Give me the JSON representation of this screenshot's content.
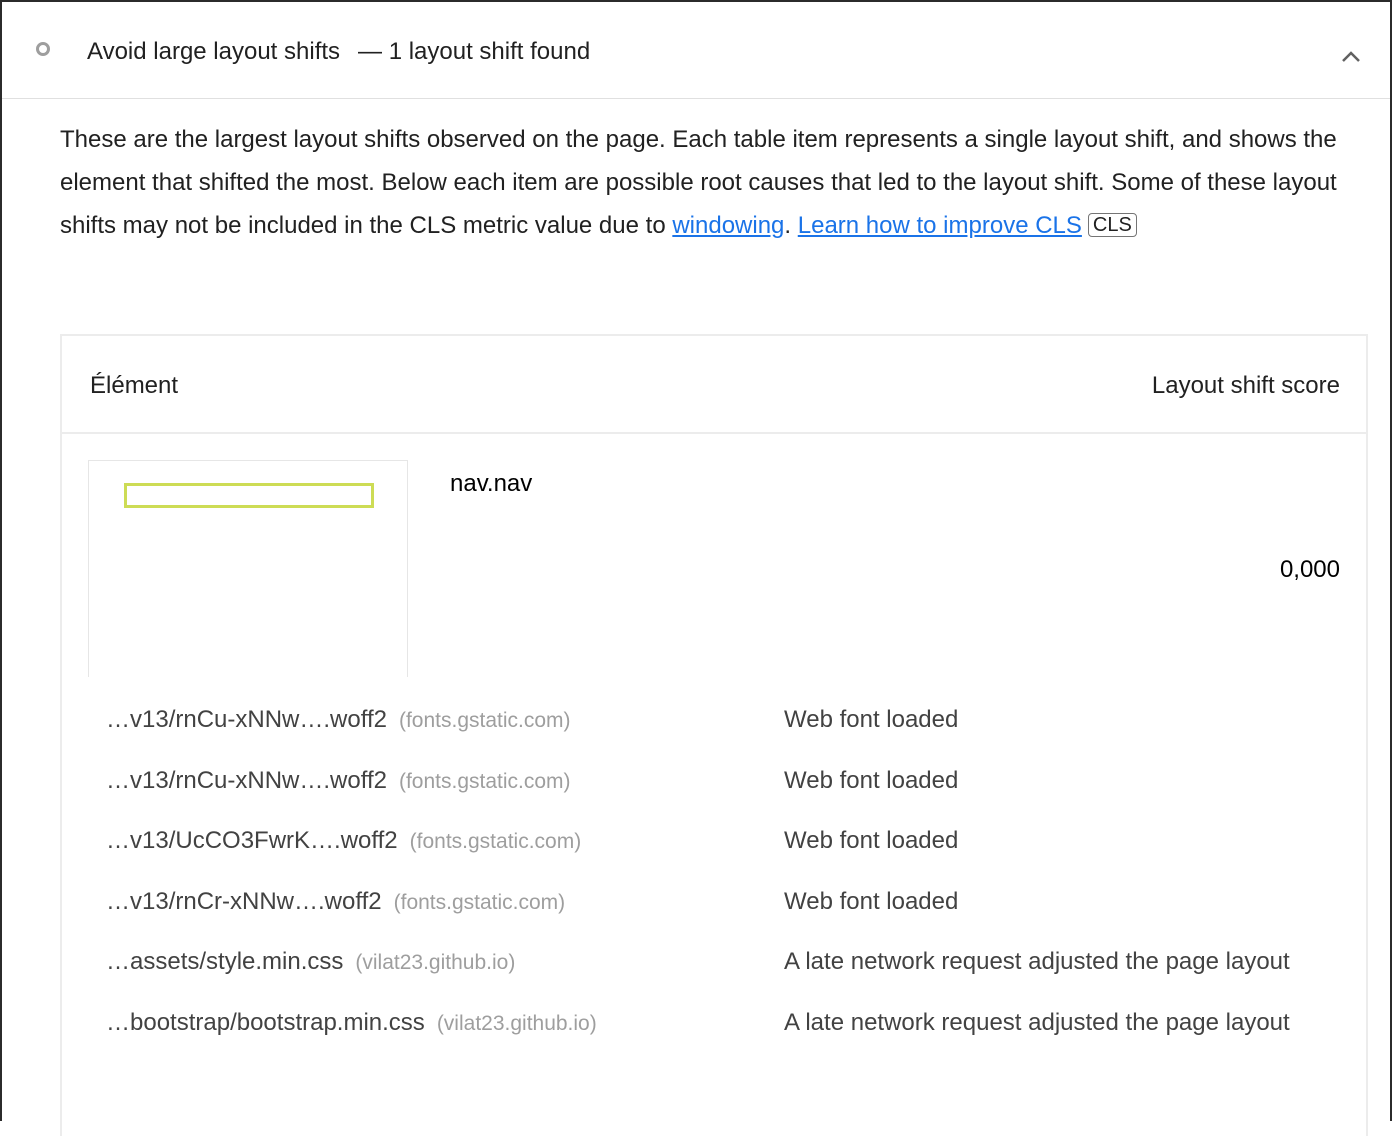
{
  "audit": {
    "title": "Avoid large layout shifts",
    "separator": "—",
    "display_value": "1 layout shift found",
    "expanded_icon": "chevron-up-icon",
    "status_icon": "informative-circle-icon"
  },
  "description": {
    "text_before": "These are the largest layout shifts observed on the page. Each table item represents a single layout shift, and shows the element that shifted the most. Below each item are possible root causes that led to the layout shift. Some of these layout shifts may not be included in the CLS metric value due to ",
    "link_windowing": "windowing",
    "text_between": ". ",
    "link_learn": "Learn how to improve CLS",
    "badge": "CLS"
  },
  "table": {
    "headers": {
      "element": "Élément",
      "score": "Layout shift score"
    },
    "item": {
      "node_label": "nav.nav",
      "score": "0,000"
    },
    "root_causes": [
      {
        "url": "…v13/rnCu-xNNw….woff2",
        "host": "(fonts.gstatic.com)",
        "reason": "Web font loaded"
      },
      {
        "url": "…v13/rnCu-xNNw….woff2",
        "host": "(fonts.gstatic.com)",
        "reason": "Web font loaded"
      },
      {
        "url": "…v13/UcCO3FwrK….woff2",
        "host": "(fonts.gstatic.com)",
        "reason": "Web font loaded"
      },
      {
        "url": "…v13/rnCr-xNNw….woff2",
        "host": "(fonts.gstatic.com)",
        "reason": "Web font loaded"
      },
      {
        "url": "…assets/style.min.css",
        "host": "(vilat23.github.io)",
        "reason": "A late network request adjusted the page layout"
      },
      {
        "url": "…bootstrap/bootstrap.min.css",
        "host": "(vilat23.github.io)",
        "reason": "A late network request adjusted the page layout"
      }
    ]
  },
  "colors": {
    "link": "#1a73e8",
    "highlight": "#cddc55",
    "muted": "#9e9e9e"
  }
}
